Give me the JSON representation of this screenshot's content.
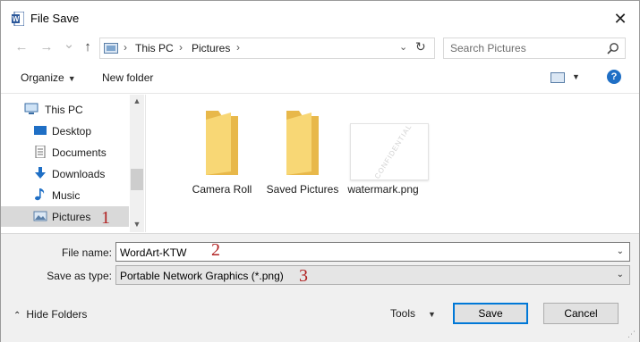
{
  "window": {
    "title": "File Save",
    "close_glyph": "✕",
    "app_icon": "word-app-icon"
  },
  "nav": {
    "back_glyph": "←",
    "forward_glyph": "→",
    "recent_glyph": "⌄",
    "up_glyph": "↑"
  },
  "address": {
    "crumbs": [
      "This PC",
      "Pictures"
    ],
    "sep": "›",
    "drop_glyph": "⌄",
    "refresh_glyph": "↻"
  },
  "search": {
    "placeholder": "Search Pictures"
  },
  "toolbar": {
    "organize": "Organize",
    "new_folder": "New folder",
    "help": "?",
    "caret": "▼"
  },
  "sidebar": {
    "items": [
      {
        "label": "This PC",
        "icon": "computer-icon"
      },
      {
        "label": "Desktop",
        "icon": "desktop-icon"
      },
      {
        "label": "Documents",
        "icon": "documents-icon"
      },
      {
        "label": "Downloads",
        "icon": "downloads-icon"
      },
      {
        "label": "Music",
        "icon": "music-icon"
      },
      {
        "label": "Pictures",
        "icon": "pictures-icon",
        "selected": true
      }
    ],
    "scroll_up": "▲",
    "scroll_down": "▼"
  },
  "files": [
    {
      "name": "Camera Roll",
      "type": "folder"
    },
    {
      "name": "Saved Pictures",
      "type": "folder"
    },
    {
      "name": "watermark.png",
      "type": "image",
      "thumbnail_text": "CONFIDENTIAL"
    }
  ],
  "form": {
    "file_name_label": "File name:",
    "file_name_value": "WordArt-KTW",
    "save_type_label": "Save as type:",
    "save_type_value": "Portable Network Graphics (*.png)",
    "dropdown_glyph": "⌄"
  },
  "callouts": [
    "1",
    "2",
    "3"
  ],
  "footer": {
    "hide_folders": "Hide Folders",
    "hide_chevron": "⌃",
    "tools": "Tools",
    "save": "Save",
    "cancel": "Cancel",
    "grip": "⋰"
  },
  "colors": {
    "accent": "#0078d7",
    "callout": "#b02020",
    "folder": "#f8d775",
    "selected": "#d9d9d9"
  }
}
